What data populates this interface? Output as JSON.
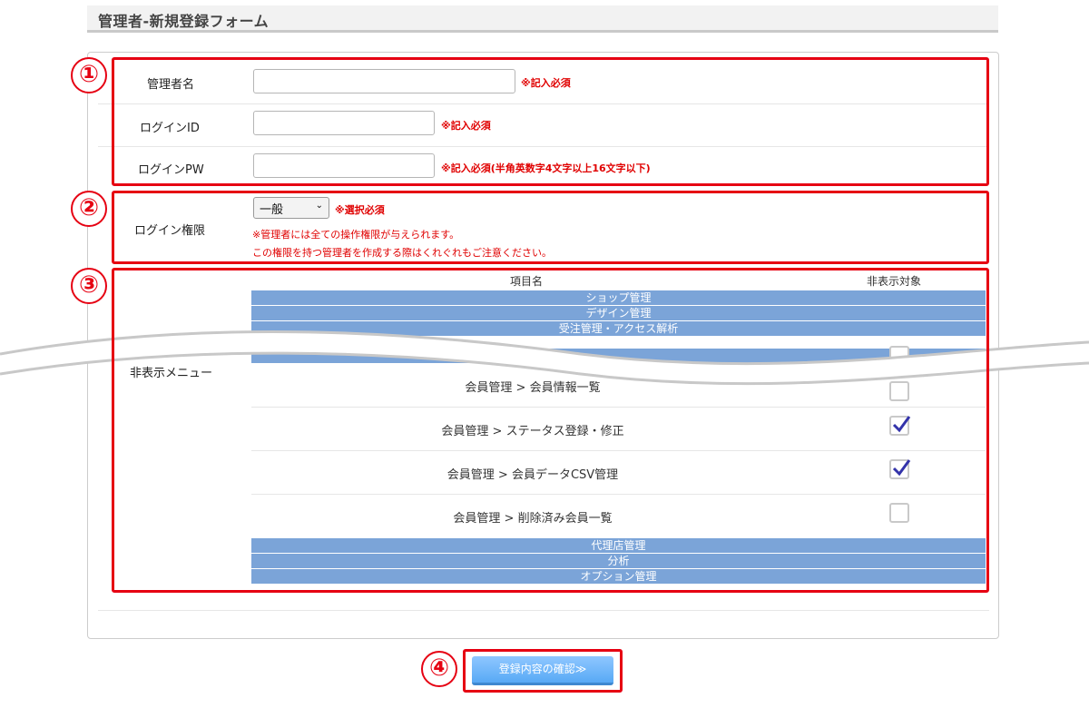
{
  "page": {
    "title": "管理者-新規登録フォーム"
  },
  "form": {
    "admin_name": {
      "label": "管理者名",
      "value": "",
      "required_note": "※記入必須"
    },
    "login_id": {
      "label": "ログインID",
      "value": "",
      "required_note": "※記入必須"
    },
    "login_pw": {
      "label": "ログインPW",
      "value": "",
      "required_note": "※記入必須(半角英数字4文字以上16文字以下)"
    },
    "permission": {
      "label": "ログイン権限",
      "selected": "一般",
      "required_note": "※選択必須",
      "note_line1": "※管理者には全ての操作権限が与えられます。",
      "note_line2": "この権限を持つ管理者を作成する際はくれぐれもご注意ください。"
    },
    "hidden_menu": {
      "label": "非表示メニュー",
      "col_item": "項目名",
      "col_hidden": "非表示対象",
      "categories_top": [
        "ショップ管理",
        "デザイン管理",
        "受注管理・アクセス解析"
      ],
      "items": [
        {
          "label": "会員管理 > 会員情報一覧",
          "checked": false
        },
        {
          "label": "会員管理 > ステータス登録・修正",
          "checked": true
        },
        {
          "label": "会員管理 > 会員データCSV管理",
          "checked": true
        },
        {
          "label": "会員管理 > 削除済み会員一覧",
          "checked": false
        }
      ],
      "categories_bottom": [
        "代理店管理",
        "分析",
        "オプション管理"
      ]
    }
  },
  "buttons": {
    "confirm": "登録内容の確認≫"
  },
  "callouts": [
    "①",
    "②",
    "③",
    "④"
  ],
  "colors": {
    "frame": "#e60012",
    "category_bar": "#7ba4d8",
    "required": "#e00000",
    "check": "#3333aa"
  }
}
